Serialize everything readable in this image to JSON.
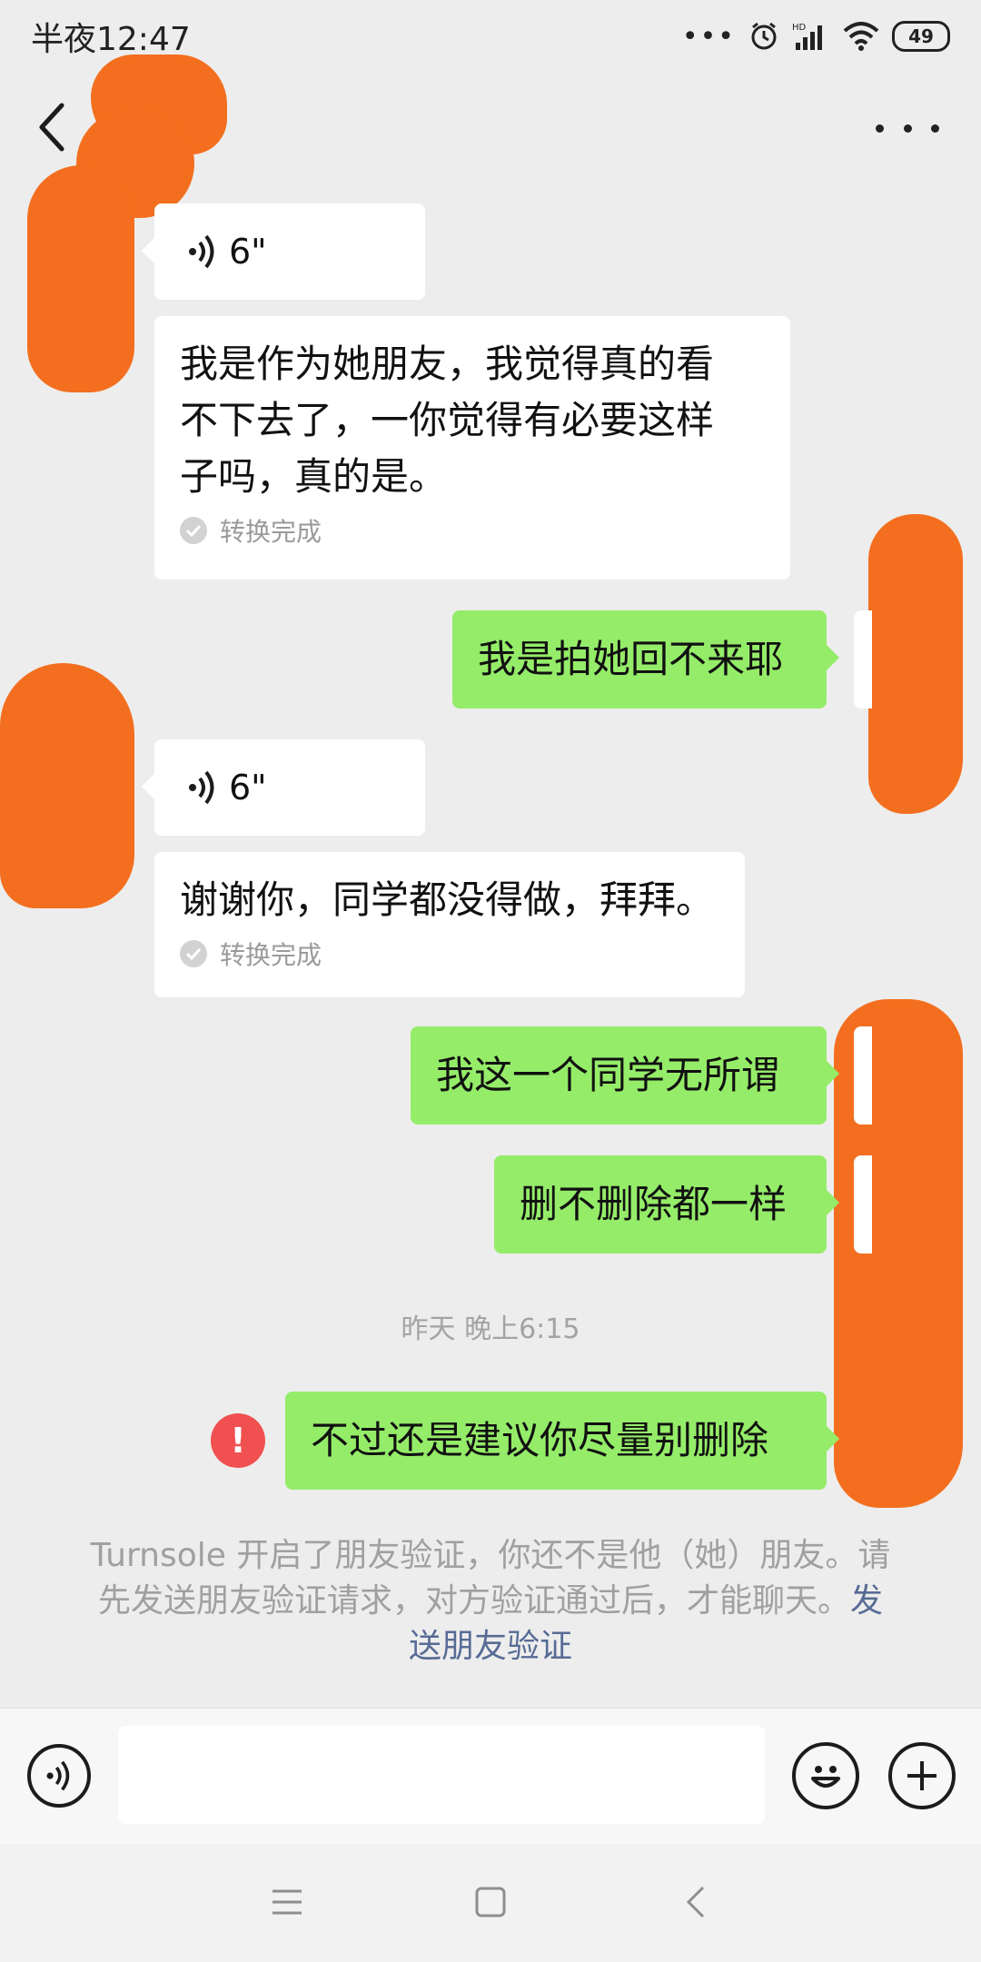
{
  "status_bar": {
    "time": "半夜12:47",
    "battery": "49"
  },
  "messages": [
    {
      "side": "left",
      "type": "voice",
      "duration": "6\""
    },
    {
      "side": "left",
      "type": "text",
      "lines": [
        "我是作为她朋友，我觉得真的看",
        "不下去了，一你觉得有必要这样",
        "子吗，真的是。"
      ],
      "conversion": "转换完成"
    },
    {
      "side": "right",
      "type": "text",
      "text": "我是拍她回不来耶"
    },
    {
      "side": "left",
      "type": "voice",
      "duration": "6\""
    },
    {
      "side": "left",
      "type": "text",
      "lines": [
        "谢谢你，同学都没得做，拜拜。"
      ],
      "conversion": "转换完成"
    },
    {
      "side": "right",
      "type": "text",
      "text": "我这一个同学无所谓"
    },
    {
      "side": "right",
      "type": "text",
      "text": "删不删除都一样"
    },
    {
      "side": "right",
      "type": "text",
      "text": "不过还是建议你尽量别删除",
      "failed": true
    }
  ],
  "timestamp": "昨天 晚上6:15",
  "error_icon": "!",
  "notice": {
    "line1": "Turnsole 开启了朋友验证，你还不是他（她）朋友。请",
    "line2_text": "先发送朋友验证请求，对方验证通过后，才能聊天。",
    "link_part1": "发",
    "link_part2": "送朋友验证"
  },
  "icons": {
    "back": "chevron-left-icon",
    "more": "more-dots-icon",
    "voice_toggle": "voice-icon",
    "emoji": "emoji-icon",
    "plus": "plus-icon"
  },
  "colors": {
    "background": "#ededed",
    "my_bubble": "#95ec69",
    "other_bubble": "#ffffff",
    "error": "#f05050",
    "link": "#576b95",
    "redaction": "#f36f1f"
  }
}
